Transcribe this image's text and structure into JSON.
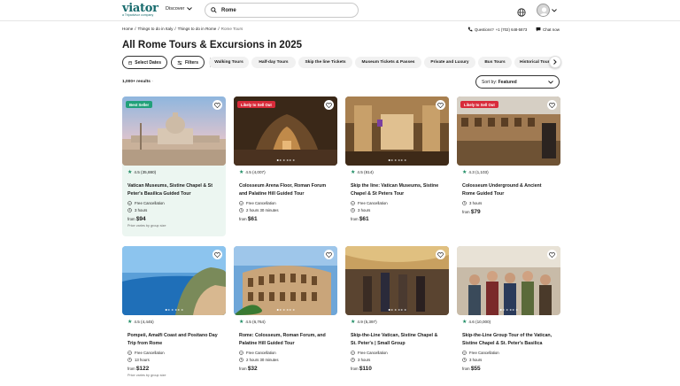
{
  "header": {
    "logo": "viator",
    "logo_sub": "a Tripadvisor company",
    "discover": "Discover",
    "search_value": "Rome"
  },
  "breadcrumbs": [
    "Home",
    "Things to do in Italy",
    "Things to do in Rome",
    "Rome Tours"
  ],
  "help": {
    "questions_label": "Questions?",
    "phone": "+1 (702) 648-5873",
    "chat": "Chat now"
  },
  "title": "All Rome Tours & Excursions in 2025",
  "filters": {
    "select_dates": "Select Dates",
    "filters": "Filters",
    "chips": [
      "Walking Tours",
      "Half-day Tours",
      "Skip the line Tickets",
      "Museum Tickets & Passes",
      "Private and Luxury",
      "Bus Tours",
      "Historical Tours"
    ]
  },
  "results": "1,000+ results",
  "sort": {
    "prefix": "Sort by:",
    "value": "Featured"
  },
  "cards": [
    {
      "badge": "Best Seller",
      "rating": "4.5 (35,880)",
      "title": "Vatican Museums, Sistine Chapel & St Peter's Basilica Guided Tour",
      "cancel": "Free Cancellation",
      "duration": "3 hours",
      "from": "from",
      "price": "$94",
      "note": "Price varies by group size"
    },
    {
      "badge": "Likely to Sell Out",
      "rating": "4.5 (4,007)",
      "title": "Colosseum Arena Floor, Roman Forum and Palatine Hill Guided Tour",
      "cancel": "Free Cancellation",
      "duration": "2 hours 30 minutes",
      "from": "from",
      "price": "$61"
    },
    {
      "rating": "4.5 (814)",
      "title": "Skip the line: Vatican Museums, Sistine Chapel & St Peters Tour",
      "cancel": "Free Cancellation",
      "duration": "3 hours",
      "from": "from",
      "price": "$61"
    },
    {
      "badge": "Likely to Sell Out",
      "rating": "4.3 (1,103)",
      "title": "Colosseum Underground & Ancient Rome Guided Tour",
      "duration": "3 hours",
      "from": "from",
      "price": "$79"
    },
    {
      "rating": "4.5 (4,445)",
      "title": "Pompeii, Amalfi Coast and Positano Day Trip from Rome",
      "cancel": "Free Cancellation",
      "duration": "13 hours",
      "from": "from",
      "price": "$122",
      "note": "Price varies by group size"
    },
    {
      "rating": "4.5 (6,764)",
      "title": "Rome: Colosseum, Roman Forum, and Palatine Hill Guided Tour",
      "cancel": "Free Cancellation",
      "duration": "2 hours 30 minutes",
      "from": "from",
      "price": "$32"
    },
    {
      "rating": "4.9 (5,397)",
      "title": "Skip-the-Line Vatican, Sistine Chapel & St. Peter's | Small Group",
      "cancel": "Free Cancellation",
      "duration": "3 hours",
      "from": "from",
      "price": "$110"
    },
    {
      "rating": "4.6 (10,000)",
      "title": "Skip-the-Line Group Tour of the Vatican, Sistine Chapel & St. Peter's Basilica",
      "cancel": "Free Cancellation",
      "duration": "3 hours",
      "from": "from",
      "price": "$55"
    }
  ],
  "colors": {
    "brand": "#186b6d",
    "best_seller": "#21a079",
    "sell_out": "#d82b3a",
    "star": "#1b8b62"
  }
}
